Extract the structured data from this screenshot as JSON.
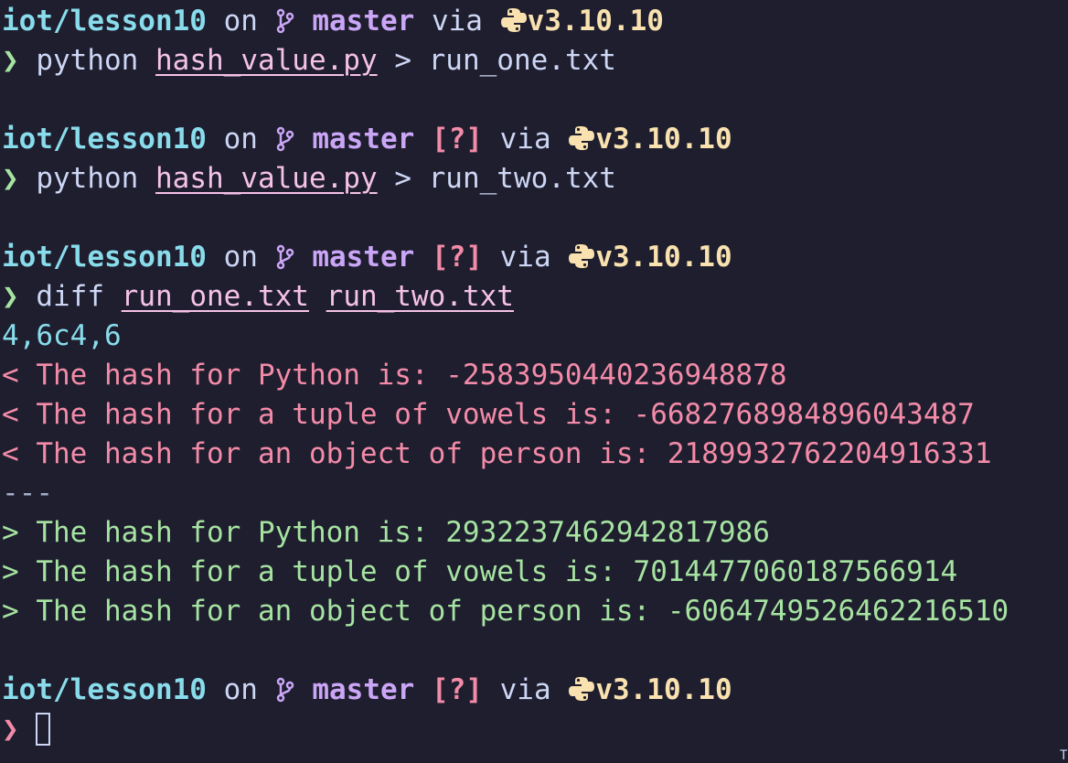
{
  "prompts": [
    {
      "dir": "iot/lesson10",
      "on": "on",
      "branch": "master",
      "status": "",
      "via": "via",
      "version": "v3.10.10",
      "symbol": "❯",
      "command": "python",
      "args": [
        "hash_value.py"
      ],
      "redirect": "> run_one.txt"
    },
    {
      "dir": "iot/lesson10",
      "on": "on",
      "branch": "master",
      "status": "[?]",
      "via": "via",
      "version": "v3.10.10",
      "symbol": "❯",
      "command": "python",
      "args": [
        "hash_value.py"
      ],
      "redirect": "> run_two.txt"
    },
    {
      "dir": "iot/lesson10",
      "on": "on",
      "branch": "master",
      "status": "[?]",
      "via": "via",
      "version": "v3.10.10",
      "symbol": "❯",
      "command": "diff",
      "args": [
        "run_one.txt",
        "run_two.txt"
      ],
      "redirect": ""
    },
    {
      "dir": "iot/lesson10",
      "on": "on",
      "branch": "master",
      "status": "[?]",
      "via": "via",
      "version": "v3.10.10",
      "symbol": "❯",
      "command": "",
      "args": [],
      "redirect": ""
    }
  ],
  "diff_output": {
    "hunk": "4,6c4,6",
    "removed": [
      "< The hash for Python is: -2583950440236948878",
      "< The hash for a tuple of vowels is: -6682768984896043487",
      "< The hash for an object of person is: 2189932762204916331"
    ],
    "separator": "---",
    "added": [
      "> The hash for Python is: 2932237462942817986",
      "> The hash for a tuple of vowels is: 7014477060187566914",
      "> The hash for an object of person is: -6064749526462216510"
    ]
  },
  "icons": {
    "branch": "git-branch-icon",
    "language": "python-icon"
  },
  "colors": {
    "background": "#1e1e2e",
    "directory": "#89dceb",
    "branch": "#cba6f7",
    "status": "#f38ba8",
    "version": "#f9e2af",
    "prompt_success": "#a6e3a1",
    "prompt_error": "#f38ba8",
    "argument": "#f5c2e7",
    "removed": "#f38ba8",
    "added": "#a6e3a1"
  },
  "corner_glyph": "T"
}
